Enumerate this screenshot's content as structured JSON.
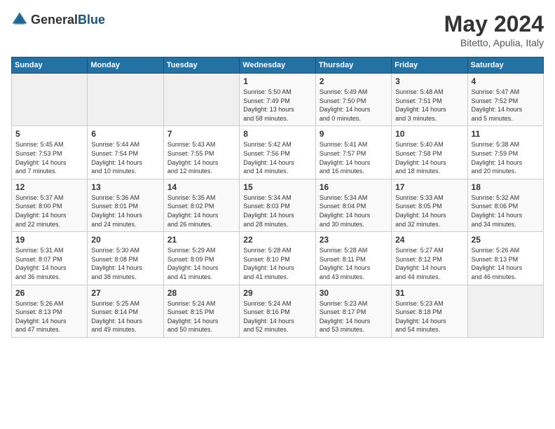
{
  "header": {
    "logo_general": "General",
    "logo_blue": "Blue",
    "title": "May 2024",
    "location": "Bitetto, Apulia, Italy"
  },
  "calendar": {
    "headers": [
      "Sunday",
      "Monday",
      "Tuesday",
      "Wednesday",
      "Thursday",
      "Friday",
      "Saturday"
    ],
    "weeks": [
      [
        {
          "day": "",
          "info": ""
        },
        {
          "day": "",
          "info": ""
        },
        {
          "day": "",
          "info": ""
        },
        {
          "day": "1",
          "info": "Sunrise: 5:50 AM\nSunset: 7:49 PM\nDaylight: 13 hours\nand 58 minutes."
        },
        {
          "day": "2",
          "info": "Sunrise: 5:49 AM\nSunset: 7:50 PM\nDaylight: 14 hours\nand 0 minutes."
        },
        {
          "day": "3",
          "info": "Sunrise: 5:48 AM\nSunset: 7:51 PM\nDaylight: 14 hours\nand 3 minutes."
        },
        {
          "day": "4",
          "info": "Sunrise: 5:47 AM\nSunset: 7:52 PM\nDaylight: 14 hours\nand 5 minutes."
        }
      ],
      [
        {
          "day": "5",
          "info": "Sunrise: 5:45 AM\nSunset: 7:53 PM\nDaylight: 14 hours\nand 7 minutes."
        },
        {
          "day": "6",
          "info": "Sunrise: 5:44 AM\nSunset: 7:54 PM\nDaylight: 14 hours\nand 10 minutes."
        },
        {
          "day": "7",
          "info": "Sunrise: 5:43 AM\nSunset: 7:55 PM\nDaylight: 14 hours\nand 12 minutes."
        },
        {
          "day": "8",
          "info": "Sunrise: 5:42 AM\nSunset: 7:56 PM\nDaylight: 14 hours\nand 14 minutes."
        },
        {
          "day": "9",
          "info": "Sunrise: 5:41 AM\nSunset: 7:57 PM\nDaylight: 14 hours\nand 16 minutes."
        },
        {
          "day": "10",
          "info": "Sunrise: 5:40 AM\nSunset: 7:58 PM\nDaylight: 14 hours\nand 18 minutes."
        },
        {
          "day": "11",
          "info": "Sunrise: 5:38 AM\nSunset: 7:59 PM\nDaylight: 14 hours\nand 20 minutes."
        }
      ],
      [
        {
          "day": "12",
          "info": "Sunrise: 5:37 AM\nSunset: 8:00 PM\nDaylight: 14 hours\nand 22 minutes."
        },
        {
          "day": "13",
          "info": "Sunrise: 5:36 AM\nSunset: 8:01 PM\nDaylight: 14 hours\nand 24 minutes."
        },
        {
          "day": "14",
          "info": "Sunrise: 5:35 AM\nSunset: 8:02 PM\nDaylight: 14 hours\nand 26 minutes."
        },
        {
          "day": "15",
          "info": "Sunrise: 5:34 AM\nSunset: 8:03 PM\nDaylight: 14 hours\nand 28 minutes."
        },
        {
          "day": "16",
          "info": "Sunrise: 5:34 AM\nSunset: 8:04 PM\nDaylight: 14 hours\nand 30 minutes."
        },
        {
          "day": "17",
          "info": "Sunrise: 5:33 AM\nSunset: 8:05 PM\nDaylight: 14 hours\nand 32 minutes."
        },
        {
          "day": "18",
          "info": "Sunrise: 5:32 AM\nSunset: 8:06 PM\nDaylight: 14 hours\nand 34 minutes."
        }
      ],
      [
        {
          "day": "19",
          "info": "Sunrise: 5:31 AM\nSunset: 8:07 PM\nDaylight: 14 hours\nand 36 minutes."
        },
        {
          "day": "20",
          "info": "Sunrise: 5:30 AM\nSunset: 8:08 PM\nDaylight: 14 hours\nand 38 minutes."
        },
        {
          "day": "21",
          "info": "Sunrise: 5:29 AM\nSunset: 8:09 PM\nDaylight: 14 hours\nand 41 minutes."
        },
        {
          "day": "22",
          "info": "Sunrise: 5:28 AM\nSunset: 8:10 PM\nDaylight: 14 hours\nand 41 minutes."
        },
        {
          "day": "23",
          "info": "Sunrise: 5:28 AM\nSunset: 8:11 PM\nDaylight: 14 hours\nand 43 minutes."
        },
        {
          "day": "24",
          "info": "Sunrise: 5:27 AM\nSunset: 8:12 PM\nDaylight: 14 hours\nand 44 minutes."
        },
        {
          "day": "25",
          "info": "Sunrise: 5:26 AM\nSunset: 8:13 PM\nDaylight: 14 hours\nand 46 minutes."
        }
      ],
      [
        {
          "day": "26",
          "info": "Sunrise: 5:26 AM\nSunset: 8:13 PM\nDaylight: 14 hours\nand 47 minutes."
        },
        {
          "day": "27",
          "info": "Sunrise: 5:25 AM\nSunset: 8:14 PM\nDaylight: 14 hours\nand 49 minutes."
        },
        {
          "day": "28",
          "info": "Sunrise: 5:24 AM\nSunset: 8:15 PM\nDaylight: 14 hours\nand 50 minutes."
        },
        {
          "day": "29",
          "info": "Sunrise: 5:24 AM\nSunset: 8:16 PM\nDaylight: 14 hours\nand 52 minutes."
        },
        {
          "day": "30",
          "info": "Sunrise: 5:23 AM\nSunset: 8:17 PM\nDaylight: 14 hours\nand 53 minutes."
        },
        {
          "day": "31",
          "info": "Sunrise: 5:23 AM\nSunset: 8:18 PM\nDaylight: 14 hours\nand 54 minutes."
        },
        {
          "day": "",
          "info": ""
        }
      ]
    ]
  }
}
